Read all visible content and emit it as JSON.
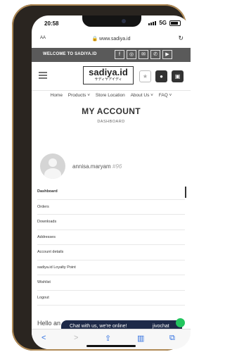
{
  "status": {
    "time": "20:58",
    "network": "5G"
  },
  "browser": {
    "text_size": "AA",
    "url": "www.sadiya.id"
  },
  "topbar": {
    "welcome": "WELCOME TO SADIYA.ID",
    "socials": [
      "f",
      "◎",
      "✉",
      "✆",
      "▶"
    ]
  },
  "header": {
    "logo": "sadiya.id",
    "logo_sub": "サディヤアイディ"
  },
  "nav": [
    "Home",
    "Products ˅",
    "Store Location",
    "About Us ˅",
    "FAQ ˅"
  ],
  "page": {
    "title": "MY ACCOUNT",
    "subtitle": "DASHBOARD"
  },
  "user": {
    "name": "annisa.maryam",
    "id": "#96"
  },
  "menu": [
    "Dashboard",
    "Orders",
    "Downloads",
    "Addresses",
    "Account details",
    "sadiya.id Loyalty Point",
    "Wishlist",
    "Logout"
  ],
  "greeting": "Hello an",
  "chat": {
    "message": "Chat with us, we're online!",
    "brand": "jivochat"
  },
  "colors": {
    "topbar": "#5a5a5a",
    "chat": "#1e2a48",
    "ios_blue": "#2f6fe0",
    "online": "#22c55e"
  }
}
